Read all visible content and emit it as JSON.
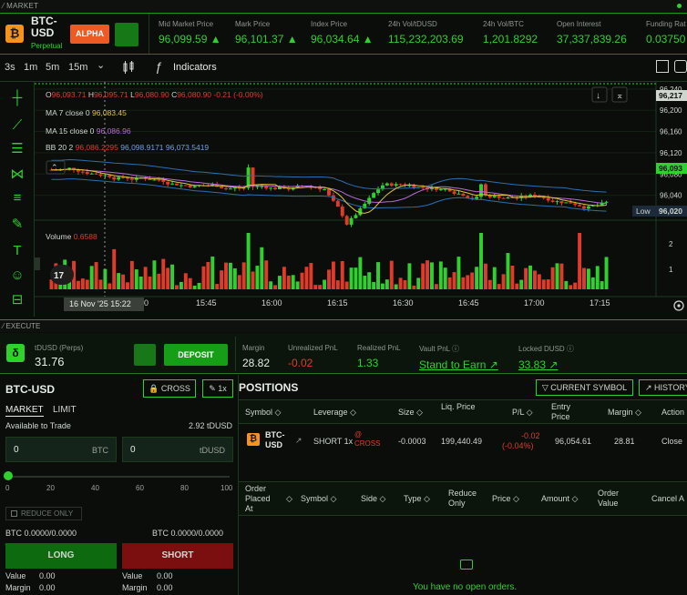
{
  "top": {
    "market_label": "⁄ MARKET"
  },
  "ticker": {
    "coin_glyph": "₿",
    "symbol": "BTC-USD",
    "subtitle": "Perpetual",
    "alpha_label": "ALPHA",
    "stats": [
      {
        "label": "Mid Market Price",
        "value": "96,099.59 ▲"
      },
      {
        "label": "Mark Price",
        "value": "96,101.37 ▲"
      },
      {
        "label": "Index Price",
        "value": "96,034.64 ▲"
      },
      {
        "label": "24h Vol/tDUSD",
        "value": "115,232,203.69"
      },
      {
        "label": "24h Vol/BTC",
        "value": "1,201.8292"
      },
      {
        "label": "Open Interest",
        "value": "37,337,839.26"
      },
      {
        "label": "Funding Rat",
        "value": "0.03750"
      }
    ]
  },
  "chart_toolbar": {
    "timeframes": [
      "3s",
      "1m",
      "5m",
      "15m"
    ],
    "dropdown_glyph": "⌄",
    "indicators_label": "Indicators",
    "fx_glyph": "ƒ"
  },
  "chart_legend": {
    "ohlc": {
      "o_label": "O",
      "o": "96,093.71",
      "h_label": "H",
      "h": "96,095.71",
      "l_label": "L",
      "l": "96,080.90",
      "c_label": "C",
      "c": "96,080.90",
      "chg": "-0.21 (-0.00%)"
    },
    "ma7": {
      "label": "MA 7 close 0",
      "value": "96,083.45"
    },
    "ma15": {
      "label": "MA 15 close 0",
      "value": "96,086.96"
    },
    "bb": {
      "label": "BB 20 2",
      "v1": "96,086.2295",
      "v2": "96,098.9171",
      "v3": "96,073.5419"
    },
    "volume": {
      "label": "Volume",
      "value": "0.6588"
    }
  },
  "chart_data": {
    "type": "candlestick",
    "price_axis": {
      "ticks": [
        "96,240",
        "96,200",
        "96,160",
        "96,120",
        "96,080",
        "96,040"
      ],
      "ylim": [
        96000,
        96250
      ]
    },
    "price_labels": {
      "top": "96,217",
      "last": "96,093",
      "low_label": "Low",
      "low": "96,020"
    },
    "volume_axis": {
      "ticks": [
        "2",
        "1"
      ]
    },
    "time_ticks": [
      "15:45",
      "16:00",
      "16:15",
      "16:30",
      "16:45",
      "17:00",
      "17:15"
    ],
    "crosshair_date": "16 Nov '25",
    "crosshair_time": "15:22",
    "crosshair_partial_tick": "0",
    "colors": {
      "up": "#2fd12f",
      "down": "#e03b2a",
      "ma7": "#e0c33a",
      "ma15": "#b86bd8",
      "bb": "#2a6fb0"
    }
  },
  "exec": {
    "label": "⁄ EXECUTE"
  },
  "account": {
    "glyph": "δ",
    "name": "tDUSD (Perps)",
    "balance": "31.76",
    "deposit_label": "DEPOSIT",
    "margin_label": "Margin",
    "margin": "28.82",
    "upnl_label": "Unrealized PnL",
    "upnl": "-0.02",
    "rpnl_label": "Realized PnL",
    "rpnl": "1.33",
    "vault_label": "Vault PnL ⓘ",
    "vault": "Stand to Earn ↗",
    "locked_label": "Locked DUSD ⓘ",
    "locked": "33.83 ↗"
  },
  "order": {
    "title": "BTC-USD",
    "cross_label": "🔒 CROSS",
    "leverage_label": "✎ 1x",
    "tab_market": "MARKET",
    "tab_limit": "LIMIT",
    "avail_label": "Available to Trade",
    "avail_value": "2.92 tDUSD",
    "input_btc": "0",
    "unit_btc": "BTC",
    "input_usd": "0",
    "unit_usd": "tDUSD",
    "slider_ticks": [
      "0",
      "20",
      "40",
      "60",
      "80",
      "100"
    ],
    "slider_value_pct": 0,
    "reduce_label": "REDUCE ONLY",
    "btc_left": "BTC 0.0000/0.0000",
    "btc_right": "BTC 0.0000/0.0000",
    "long_label": "LONG",
    "short_label": "SHORT",
    "value_label": "Value",
    "margin_label": "Margin",
    "long_value": "0.00",
    "long_margin": "0.00",
    "short_value": "0.00",
    "short_margin": "0.00"
  },
  "positions": {
    "title": "POSITIONS",
    "current_symbol_label": "▽ CURRENT SYMBOL",
    "history_label": "↗ HISTORY",
    "headers": [
      "Symbol ◇",
      "Leverage ◇",
      "Size ◇",
      "Liq. Price",
      "P/L ◇",
      "Entry Price",
      "Margin ◇",
      "Action"
    ],
    "row": {
      "symbol": "BTC-USD",
      "link_glyph": "↗",
      "leverage": "SHORT 1x",
      "mode": "@ CROSS",
      "size": "-0.0003",
      "liq": "199,440.49",
      "pl": "-0.02",
      "pl_pct": "(-0.04%)",
      "entry": "96,054.61",
      "margin": "28.81",
      "action": "Close"
    },
    "order_headers": [
      "Order Placed At",
      "◇",
      "Symbol ◇",
      "Side ◇",
      "Type ◇",
      "Reduce Only",
      "Price ◇",
      "Amount ◇",
      "Order Value",
      "Cancel A"
    ],
    "empty_text": "You have no open orders."
  }
}
